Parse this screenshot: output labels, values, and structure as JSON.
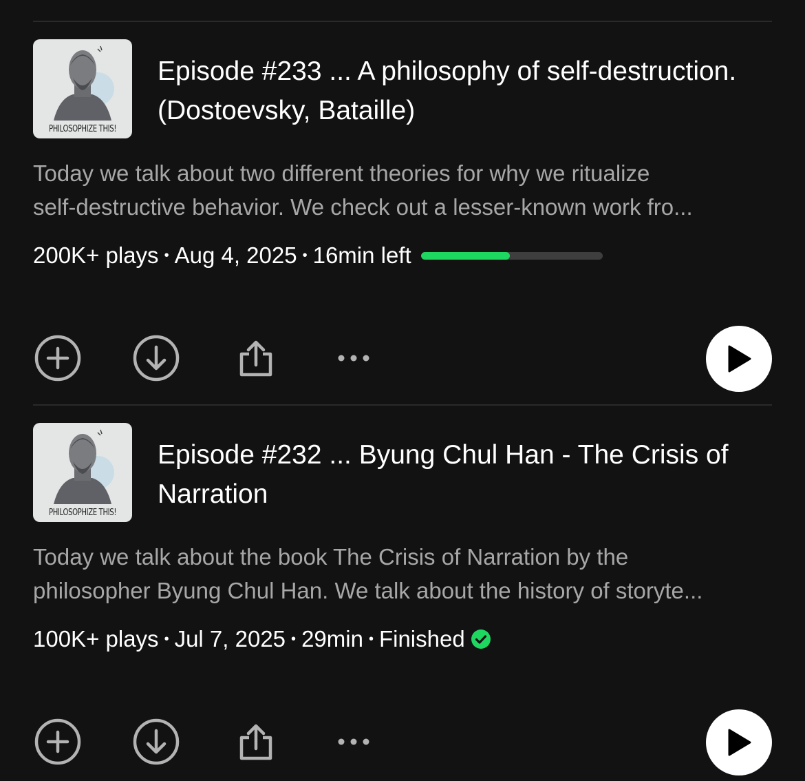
{
  "episodes": [
    {
      "cover_text": "PHILOSOPHIZE THIS!",
      "title": "Episode #233 ... A philosophy of self-destruction. (Dostoevsky, Bataille)",
      "description_line1": "Today we talk about two different theories for why we ritualize",
      "description_line2": "self-destructive behavior. We check out a lesser-known work fro...",
      "plays": "200K+ plays",
      "date": "Aug 4, 2025",
      "duration": "16min left",
      "progress_fraction": 0.49,
      "status": null,
      "status_color": "#1ed760",
      "icons": [
        "add-icon",
        "download-icon",
        "share-icon",
        "more-icon",
        "play-icon"
      ]
    },
    {
      "cover_text": "PHILOSOPHIZE THIS!",
      "title": "Episode #232 ... Byung Chul Han - The Crisis of Narration",
      "description_line1": "Today we talk about the book The Crisis of Narration by the",
      "description_line2": "philosopher Byung Chul Han. We talk about the history of storyte...",
      "plays": "100K+ plays",
      "date": "Jul 7, 2025",
      "duration": "29min",
      "progress_fraction": null,
      "status": "Finished",
      "status_color": "#1ed760",
      "icons": [
        "add-icon",
        "download-icon",
        "share-icon",
        "more-icon",
        "play-icon"
      ]
    }
  ],
  "colors": {
    "background": "#121212",
    "accent": "#1ed760",
    "secondary_text": "#a7a7a7"
  }
}
